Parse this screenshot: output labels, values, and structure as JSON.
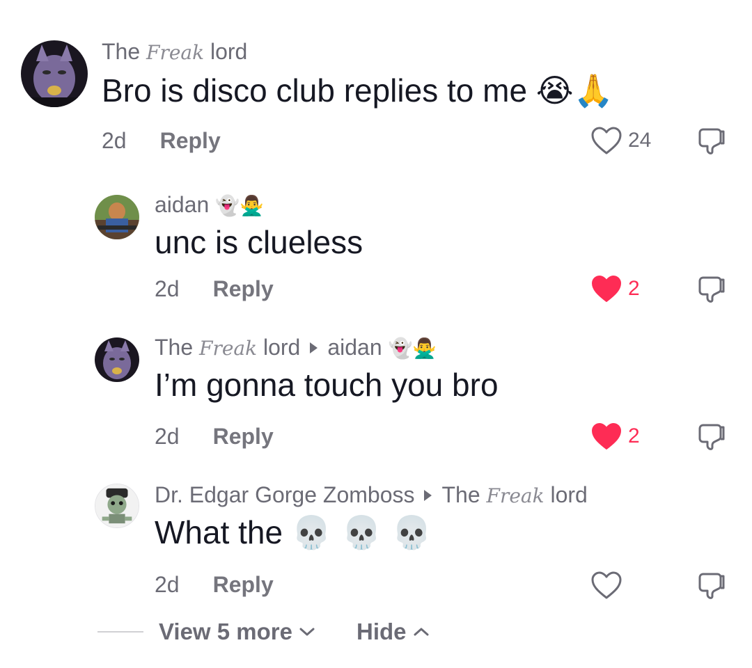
{
  "comments": [
    {
      "username": "The",
      "username_fancy": "Freak",
      "username_end": "lord",
      "text": "Bro is disco club replies to me",
      "text_emoji": "😭🙏",
      "time": "2d",
      "reply_label": "Reply",
      "like_count": "24",
      "liked": false
    },
    {
      "username": "aidan",
      "username_emoji": "👻🙅‍♂️",
      "text": "unc is clueless",
      "time": "2d",
      "reply_label": "Reply",
      "like_count": "2",
      "liked": true
    },
    {
      "username": "The",
      "username_fancy": "Freak",
      "username_end": "lord",
      "reply_to": "aidan",
      "reply_to_emoji": "👻🙅‍♂️",
      "text": "I’m gonna touch you bro",
      "time": "2d",
      "reply_label": "Reply",
      "like_count": "2",
      "liked": true
    },
    {
      "username": "Dr. Edgar Gorge Zomboss",
      "reply_to": "The",
      "reply_to_fancy": "Freak",
      "reply_to_end": "lord",
      "text": "What the",
      "text_emoji": "💀 💀 💀",
      "time": "2d",
      "reply_label": "Reply",
      "like_count": "",
      "liked": false
    }
  ],
  "footer": {
    "view_more": "View 5 more",
    "hide": "Hide"
  },
  "colors": {
    "text": "#161823",
    "muted": "#6b6b75",
    "like_active": "#fe2c55"
  }
}
